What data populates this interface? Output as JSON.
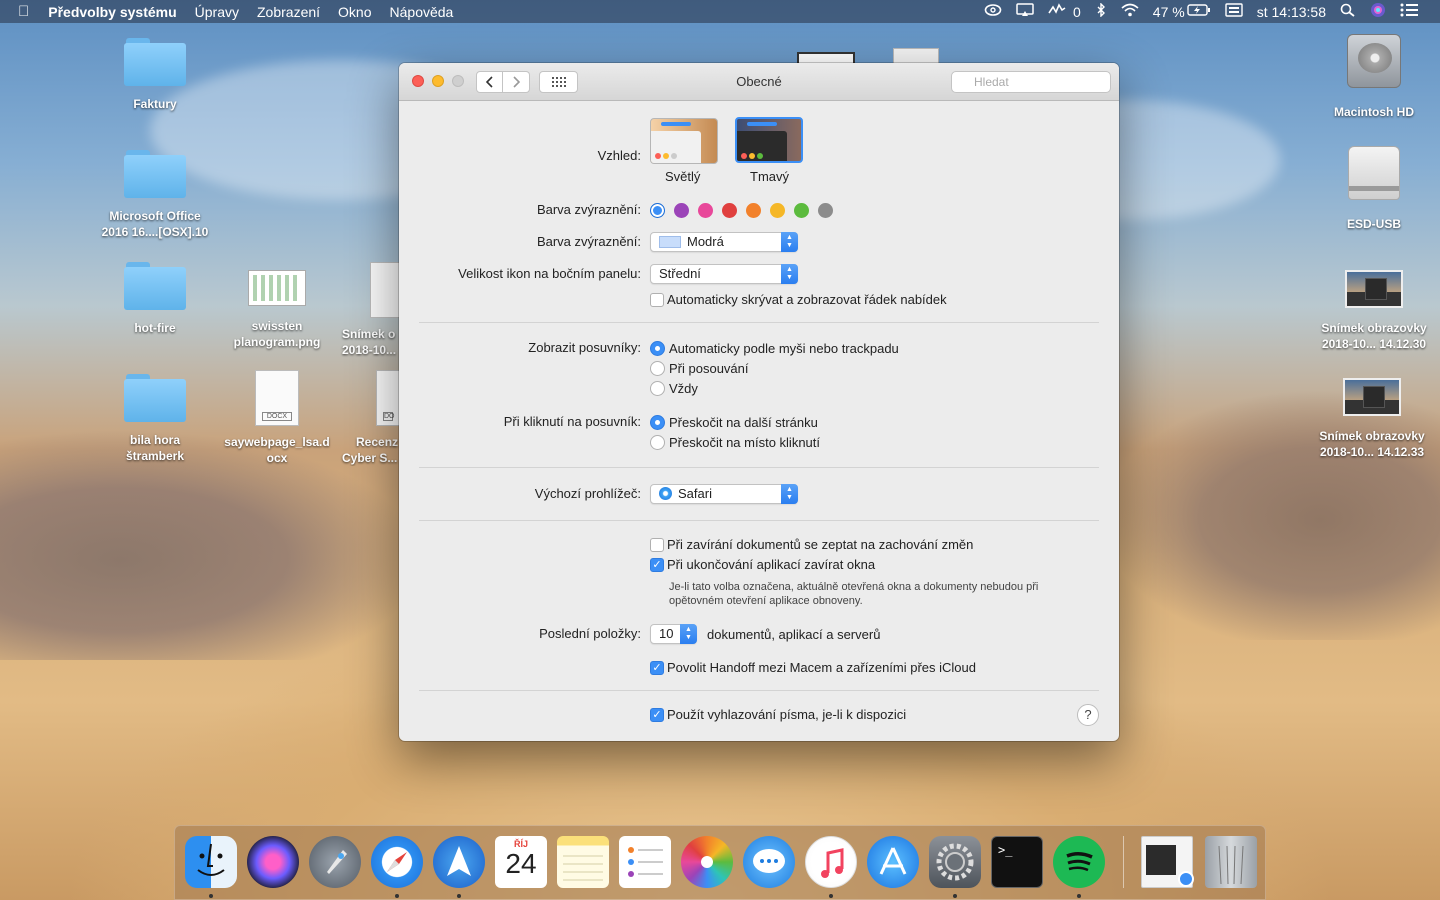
{
  "menubar": {
    "apple": "",
    "app_name": "Předvolby systému",
    "menus": [
      "Úpravy",
      "Zobrazení",
      "Okno",
      "Nápověda"
    ],
    "status": {
      "cpu_value": "0",
      "battery": "47 %",
      "clock": "st 14:13:58"
    }
  },
  "desktop": {
    "left_icons": [
      {
        "label1": "Faktury",
        "label2": ""
      },
      {
        "label1": "Microsoft Office",
        "label2": "2016 16....[OSX].10"
      },
      {
        "label1": "hot-fire",
        "label2": ""
      },
      {
        "label1": "bila hora",
        "label2": "štramberk"
      }
    ],
    "mid_icons": [
      {
        "label1": "swissten",
        "label2": "planogram.png"
      },
      {
        "label1": "saywebpage_lsa.d",
        "label2": "ocx",
        "badge": "DOCX"
      },
      {
        "label1": "Snímek o",
        "label2": "2018-10..."
      },
      {
        "label1": "Recenz",
        "label2": "Cyber S...",
        "badge": "DO"
      }
    ],
    "right_icons": [
      {
        "label1": "Macintosh HD",
        "label2": ""
      },
      {
        "label1": "ESD-USB",
        "label2": ""
      },
      {
        "label1": "Snímek obrazovky",
        "label2": "2018-10... 14.12.30"
      },
      {
        "label1": "Snímek obrazovky",
        "label2": "2018-10... 14.12.33"
      }
    ]
  },
  "window": {
    "title": "Obecné",
    "search_placeholder": "Hledat",
    "nav_back": "‹",
    "nav_forward": "›",
    "appearance": {
      "label": "Vzhled:",
      "light": "Světlý",
      "dark": "Tmavý"
    },
    "accent": {
      "label": "Barva zvýraznění:",
      "colors": [
        "#3b8ff6",
        "#9b44b8",
        "#e8489a",
        "#e0403f",
        "#f2812b",
        "#f5b727",
        "#5cbb3e",
        "#8c8c8c"
      ]
    },
    "highlight": {
      "label": "Barva zvýraznění:",
      "value": "Modrá"
    },
    "sidebar_size": {
      "label": "Velikost ikon na bočním panelu:",
      "value": "Střední"
    },
    "autohide_menubar": "Automaticky skrývat a zobrazovat řádek nabídek",
    "scrollbars": {
      "label": "Zobrazit posuvníky:",
      "options": [
        "Automaticky podle myši nebo trackpadu",
        "Při posouvání",
        "Vždy"
      ]
    },
    "scroll_click": {
      "label": "Při kliknutí na posuvník:",
      "options": [
        "Přeskočit na další stránku",
        "Přeskočit na místo kliknutí"
      ]
    },
    "browser": {
      "label": "Výchozí prohlížeč:",
      "value": "Safari"
    },
    "ask_keep_changes": "Při zavírání dokumentů se zeptat na zachování změn",
    "close_windows": "Při ukončování aplikací zavírat okna",
    "close_windows_note1": "Je-li tato volba označena, aktuálně otevřená okna a dokumenty nebudou při",
    "close_windows_note2": "opětovném otevření aplikace obnoveny.",
    "recent": {
      "label": "Poslední položky:",
      "value": "10",
      "suffix": "dokumentů, aplikací a serverů"
    },
    "handoff": "Povolit Handoff mezi Macem a zařízeními přes iCloud",
    "font_smoothing": "Použít vyhlazování písma, je-li k dispozici",
    "help": "?"
  },
  "dock": {
    "calendar_month": "ŘÍJ",
    "calendar_day": "24"
  }
}
